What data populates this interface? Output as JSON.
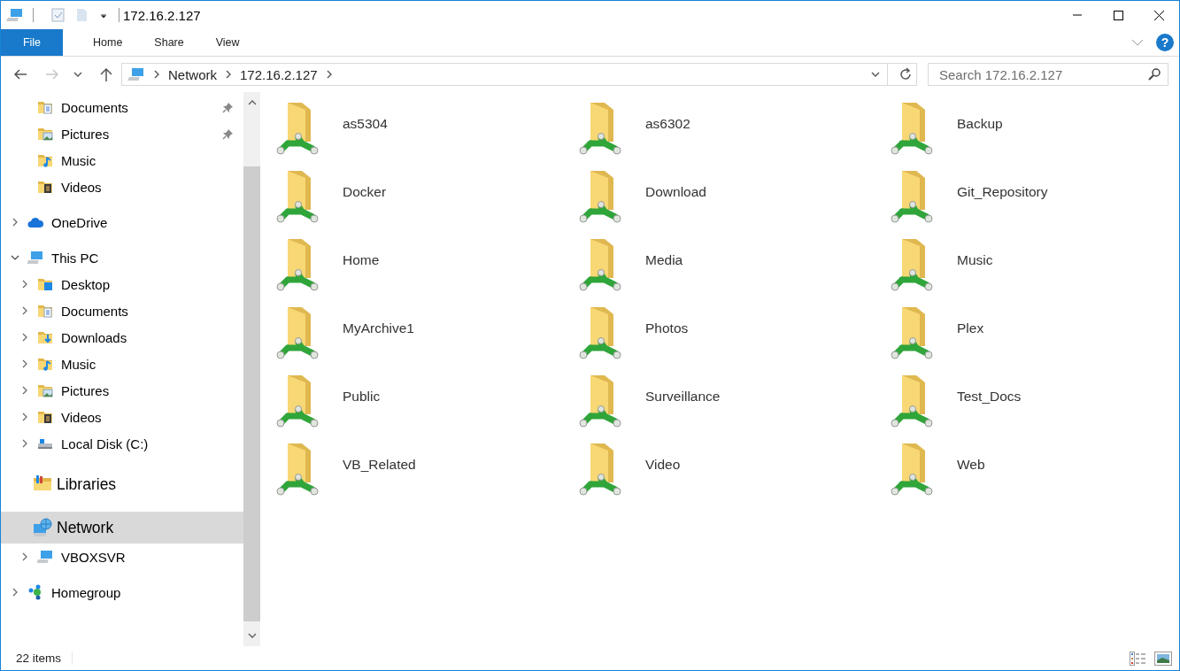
{
  "window": {
    "title": "172.16.2.127"
  },
  "ribbon": {
    "tabs": [
      {
        "label": "File",
        "kind": "file",
        "selected": false
      },
      {
        "label": "Home",
        "kind": "tab",
        "selected": false
      },
      {
        "label": "Share",
        "kind": "tab",
        "selected": false
      },
      {
        "label": "View",
        "kind": "tab",
        "selected": false
      }
    ],
    "help": "?"
  },
  "navigation": {
    "back": {
      "disabled": false
    },
    "forward": {
      "disabled": true
    }
  },
  "address_bar": {
    "breadcrumbs": [
      "Network",
      "172.16.2.127"
    ]
  },
  "search": {
    "placeholder": "Search 172.16.2.127"
  },
  "navigation_pane": {
    "quick_access": [
      {
        "label": "Documents",
        "kind": "documents",
        "pinned": true,
        "selected": false
      },
      {
        "label": "Pictures",
        "kind": "pictures",
        "pinned": true,
        "selected": false
      },
      {
        "label": "Music",
        "kind": "music",
        "pinned": false,
        "selected": false
      },
      {
        "label": "Videos",
        "kind": "videos",
        "pinned": false,
        "selected": false
      }
    ],
    "tree": [
      {
        "label": "OneDrive",
        "kind": "cloud",
        "expanded": false,
        "selected": false
      },
      {
        "label": "This PC",
        "kind": "computer",
        "expanded": true,
        "selected": false,
        "children": [
          {
            "label": "Desktop",
            "kind": "desktop",
            "expanded": false,
            "selected": false
          },
          {
            "label": "Documents",
            "kind": "documents",
            "expanded": false,
            "selected": false
          },
          {
            "label": "Downloads",
            "kind": "downloads",
            "expanded": false,
            "selected": false
          },
          {
            "label": "Music",
            "kind": "music",
            "expanded": false,
            "selected": false
          },
          {
            "label": "Pictures",
            "kind": "pictures",
            "expanded": false,
            "selected": false
          },
          {
            "label": "Videos",
            "kind": "videos",
            "expanded": false,
            "selected": false
          },
          {
            "label": "Local Disk (C:)",
            "kind": "drive",
            "expanded": false,
            "selected": false
          }
        ]
      },
      {
        "label": "Libraries",
        "kind": "libraries",
        "selected": false
      },
      {
        "label": "Network",
        "kind": "network",
        "selected": true,
        "children": [
          {
            "label": "VBOXSVR",
            "kind": "computer",
            "expanded": false,
            "selected": false
          }
        ]
      },
      {
        "label": "Homegroup",
        "kind": "homegroup",
        "expanded": false,
        "selected": false
      }
    ]
  },
  "items": [
    {
      "label": "as5304",
      "selected": false
    },
    {
      "label": "as6302",
      "selected": false
    },
    {
      "label": "Backup",
      "selected": false
    },
    {
      "label": "Docker",
      "selected": false
    },
    {
      "label": "Download",
      "selected": false
    },
    {
      "label": "Git_Repository",
      "selected": false
    },
    {
      "label": "Home",
      "selected": false
    },
    {
      "label": "Media",
      "selected": false
    },
    {
      "label": "Music",
      "selected": false
    },
    {
      "label": "MyArchive1",
      "selected": false
    },
    {
      "label": "Photos",
      "selected": false
    },
    {
      "label": "Plex",
      "selected": false
    },
    {
      "label": "Public",
      "selected": false
    },
    {
      "label": "Surveillance",
      "selected": false
    },
    {
      "label": "Test_Docs",
      "selected": false
    },
    {
      "label": "VB_Related",
      "selected": false
    },
    {
      "label": "Video",
      "selected": false
    },
    {
      "label": "Web",
      "selected": false
    }
  ],
  "status_bar": {
    "item_count": "22 items"
  }
}
